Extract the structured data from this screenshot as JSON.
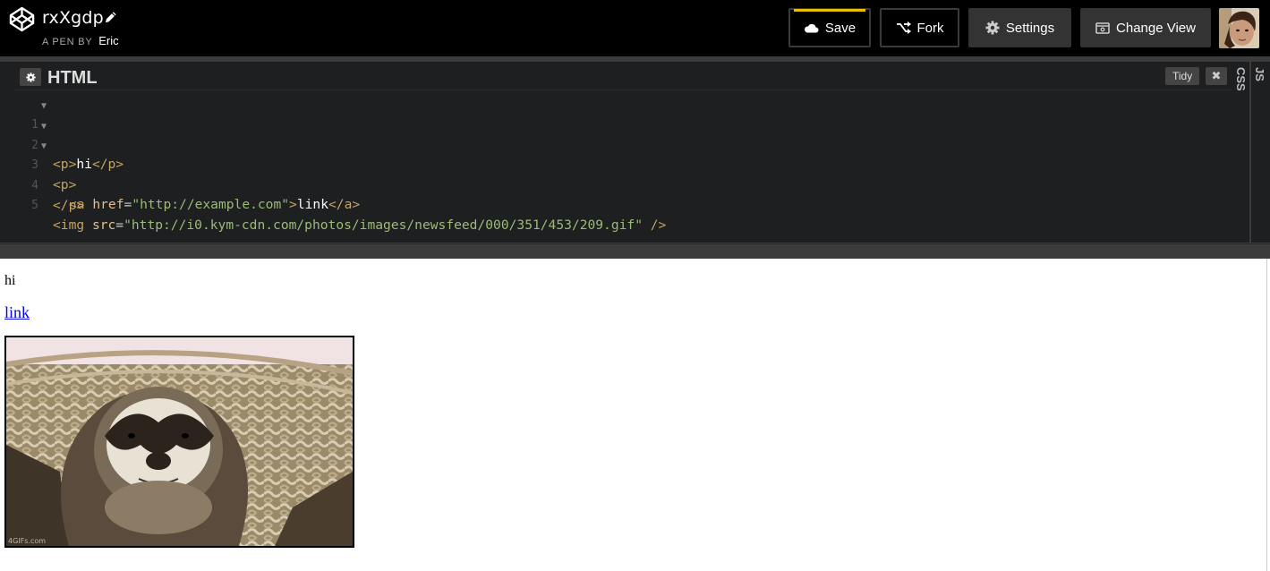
{
  "header": {
    "pen_title": "rxXgdp",
    "byline_prefix": "A PEN BY",
    "author": "Eric",
    "buttons": {
      "save": "Save",
      "fork": "Fork",
      "settings": "Settings",
      "change_view": "Change View"
    },
    "icons": {
      "logo": "codepen-logo-icon",
      "edit": "pencil-icon",
      "save": "cloud-icon",
      "fork": "fork-icon",
      "settings": "gear-icon",
      "change_view": "change-view-icon"
    },
    "accent_color": "#e6c100"
  },
  "editor": {
    "title": "HTML",
    "tidy_label": "Tidy",
    "close_label": "✖",
    "side_tabs": [
      "CSS",
      "JS"
    ],
    "lines": [
      {
        "number": "1",
        "fold": true
      },
      {
        "number": "2",
        "fold": true
      },
      {
        "number": "3",
        "fold": true
      },
      {
        "number": "4",
        "fold": false
      },
      {
        "number": "5",
        "fold": false
      }
    ],
    "code": {
      "l1": {
        "open": "<p>",
        "text": "hi",
        "close": "</p>"
      },
      "l2": {
        "open": "<p>"
      },
      "l3": {
        "open": "<a ",
        "attr": "href",
        "eq": "=",
        "value": "\"http://example.com\"",
        "gt": ">",
        "text": "link",
        "close": "</a>"
      },
      "l4": {
        "close": "</p>"
      },
      "l5": {
        "open": "<img ",
        "attr": "src",
        "eq": "=",
        "value": "\"http://i0.kym-cdn.com/photos/images/newsfeed/000/351/453/209.gif\"",
        "close": " />"
      }
    },
    "colors": {
      "tag": "#c5a265",
      "attr": "#e2c08d",
      "string": "#9bbb77",
      "background": "#1d1f20"
    }
  },
  "preview": {
    "paragraph": "hi",
    "link_text": "link",
    "image_watermark": "4GIFs.com"
  }
}
